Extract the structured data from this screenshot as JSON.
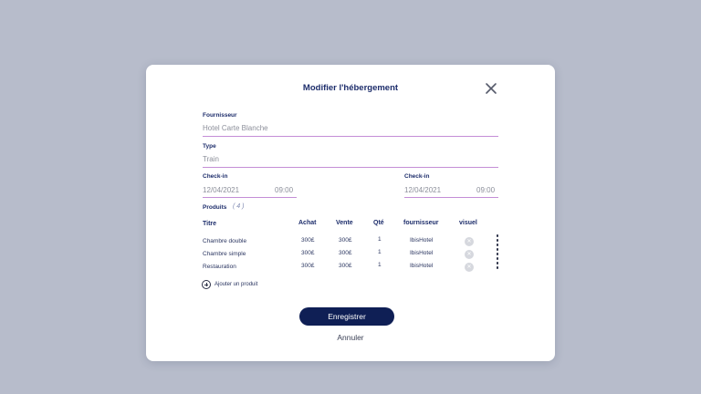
{
  "modal": {
    "title": "Modifier l'hébergement",
    "close_icon": "close-icon"
  },
  "form": {
    "fournisseur": {
      "label": "Fournisseur",
      "value": "Hotel Carte Blanche"
    },
    "type": {
      "label": "Type",
      "value": "Train"
    },
    "checkin_left": {
      "label": "Check-in",
      "date": "12/04/2021",
      "time": "09:00"
    },
    "checkin_right": {
      "label": "Check-in",
      "date": "12/04/2021",
      "time": "09:00"
    }
  },
  "products": {
    "label": "Produits",
    "count": "( 4 )",
    "headers": {
      "titre": "Titre",
      "achat": "Achat",
      "vente": "Vente",
      "qte": "Qté",
      "fournisseur": "fournisseur",
      "visuel": "visuel"
    },
    "rows": [
      {
        "titre": "Chambre double",
        "achat": "300£",
        "vente": "300£",
        "qte": "1",
        "fournisseur": "IbisHotel"
      },
      {
        "titre": "Chambre simple",
        "achat": "300£",
        "vente": "300£",
        "qte": "1",
        "fournisseur": "IbisHotel"
      },
      {
        "titre": "Restauration",
        "achat": "300£",
        "vente": "300£",
        "qte": "1",
        "fournisseur": "IbisHotel"
      }
    ],
    "add_label": "Ajouter un produit"
  },
  "actions": {
    "save": "Enregistrer",
    "cancel": "Annuler"
  },
  "colors": {
    "backdrop": "#b7bccb",
    "primary": "#0f1f55",
    "label": "#1d2d6b",
    "underline": "#c48ed6"
  }
}
